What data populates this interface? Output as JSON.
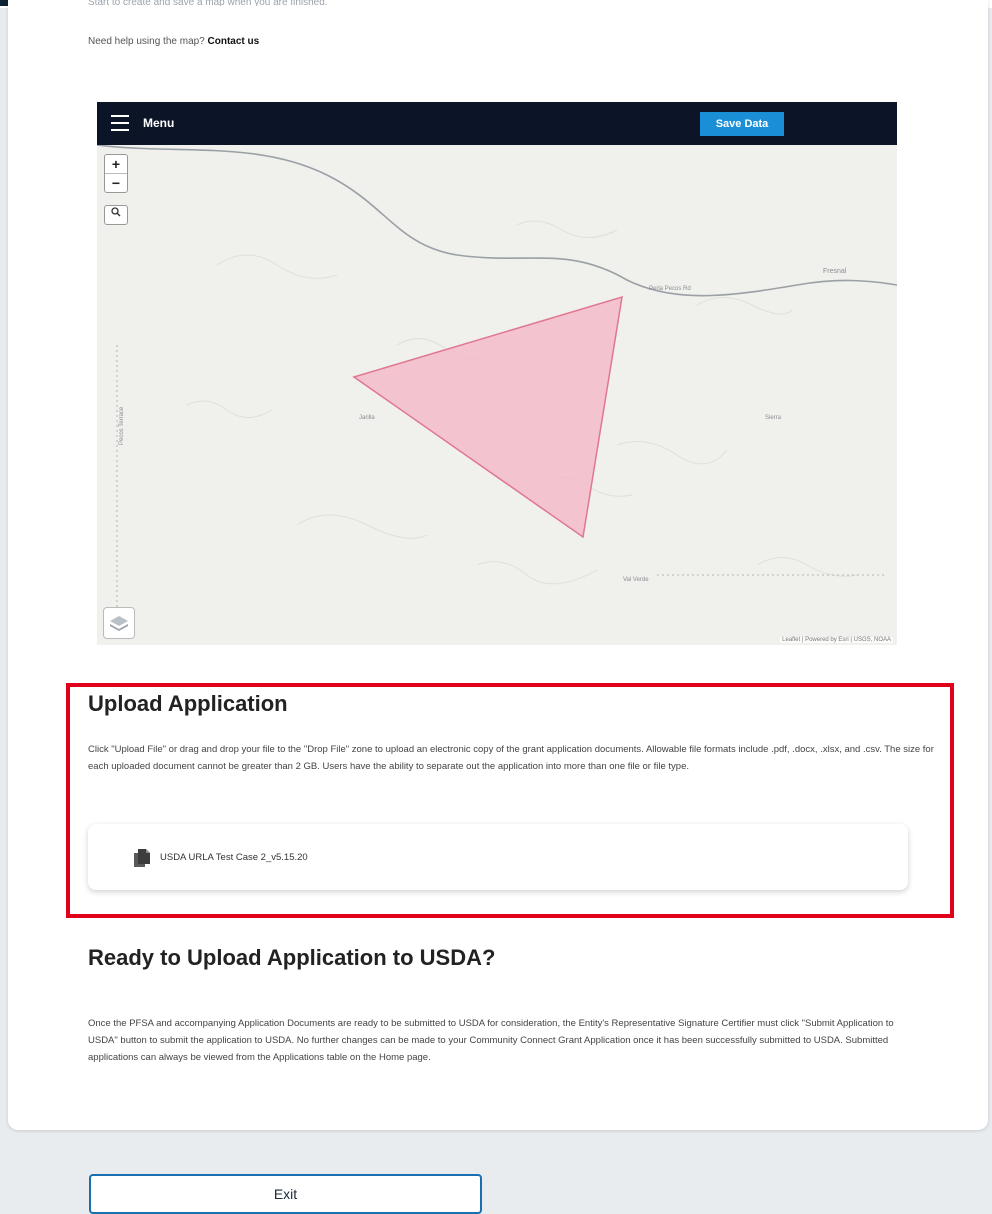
{
  "page": {
    "cut_line": "Start to create and save a map when you are finished.",
    "help_text": "Need help using the map?",
    "help_link": "Contact us"
  },
  "map": {
    "menu_label": "Menu",
    "save_button": "Save Data",
    "zoom_in": "+",
    "zoom_out": "−",
    "labels": {
      "road": "Perla Pecos Rd",
      "place_right": "Fresnal",
      "place_center": "Jarilla",
      "place_far_right": "Sierra",
      "place_bottom": "Val Verde",
      "place_left": "Pecos Terrace"
    },
    "attribution": "Leaflet | Powered by Esri | USGS, NOAA",
    "polygon_fill": "#f4b6c6",
    "polygon_stroke": "#e0778f"
  },
  "upload": {
    "title": "Upload Application",
    "description": "Click \"Upload File\" or drag and drop your file to the \"Drop File\" zone to upload an electronic copy of the grant application documents. Allowable file formats include .pdf, .docx, .xlsx, and .csv. The size for each uploaded document cannot be greater than 2 GB. Users have the ability to separate out the application into more than one file or file type.",
    "file_icon": "document-icon",
    "file_name": "USDA URLA Test Case 2_v5.15.20"
  },
  "ready": {
    "title": "Ready to Upload Application to USDA?",
    "description": "Once the PFSA and accompanying Application Documents are ready to be submitted to USDA for consideration, the Entity's Representative Signature Certifier must click \"Submit Application to USDA\" button to submit the application to USDA. No further changes can be made to your Community Connect Grant Application once it has been successfully submitted to USDA. Submitted applications can always be viewed from the Applications table on the Home page."
  },
  "actions": {
    "exit_label": "Exit"
  },
  "colors": {
    "header_dark": "#0c1528",
    "save_button": "#1a8fd8",
    "highlight_border": "#e0001a",
    "exit_border": "#1a6fb0"
  }
}
